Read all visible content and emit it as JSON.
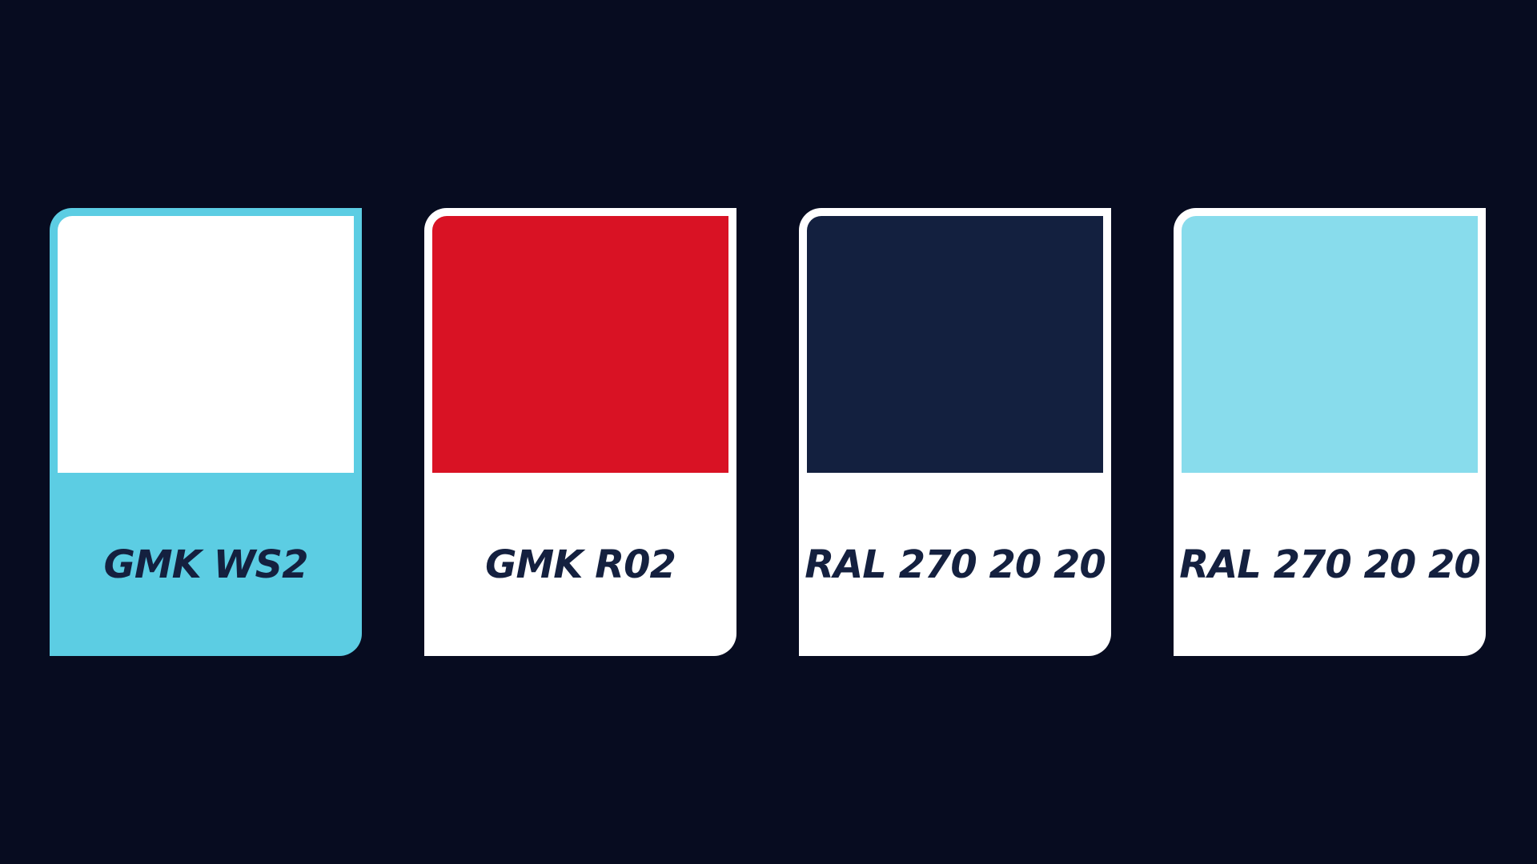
{
  "swatches": [
    {
      "label": "GMK WS2",
      "swatch_color": "#ffffff",
      "frame_color": "#5ccde3"
    },
    {
      "label": "GMK R02",
      "swatch_color": "#d91224",
      "frame_color": "#ffffff"
    },
    {
      "label": "RAL 270 20 20",
      "swatch_color": "#13203f",
      "frame_color": "#ffffff"
    },
    {
      "label": "RAL 270 20 20",
      "swatch_color": "#88dcec",
      "frame_color": "#ffffff"
    }
  ],
  "colors": {
    "background": "#070c20",
    "label_text": "#14203f"
  }
}
